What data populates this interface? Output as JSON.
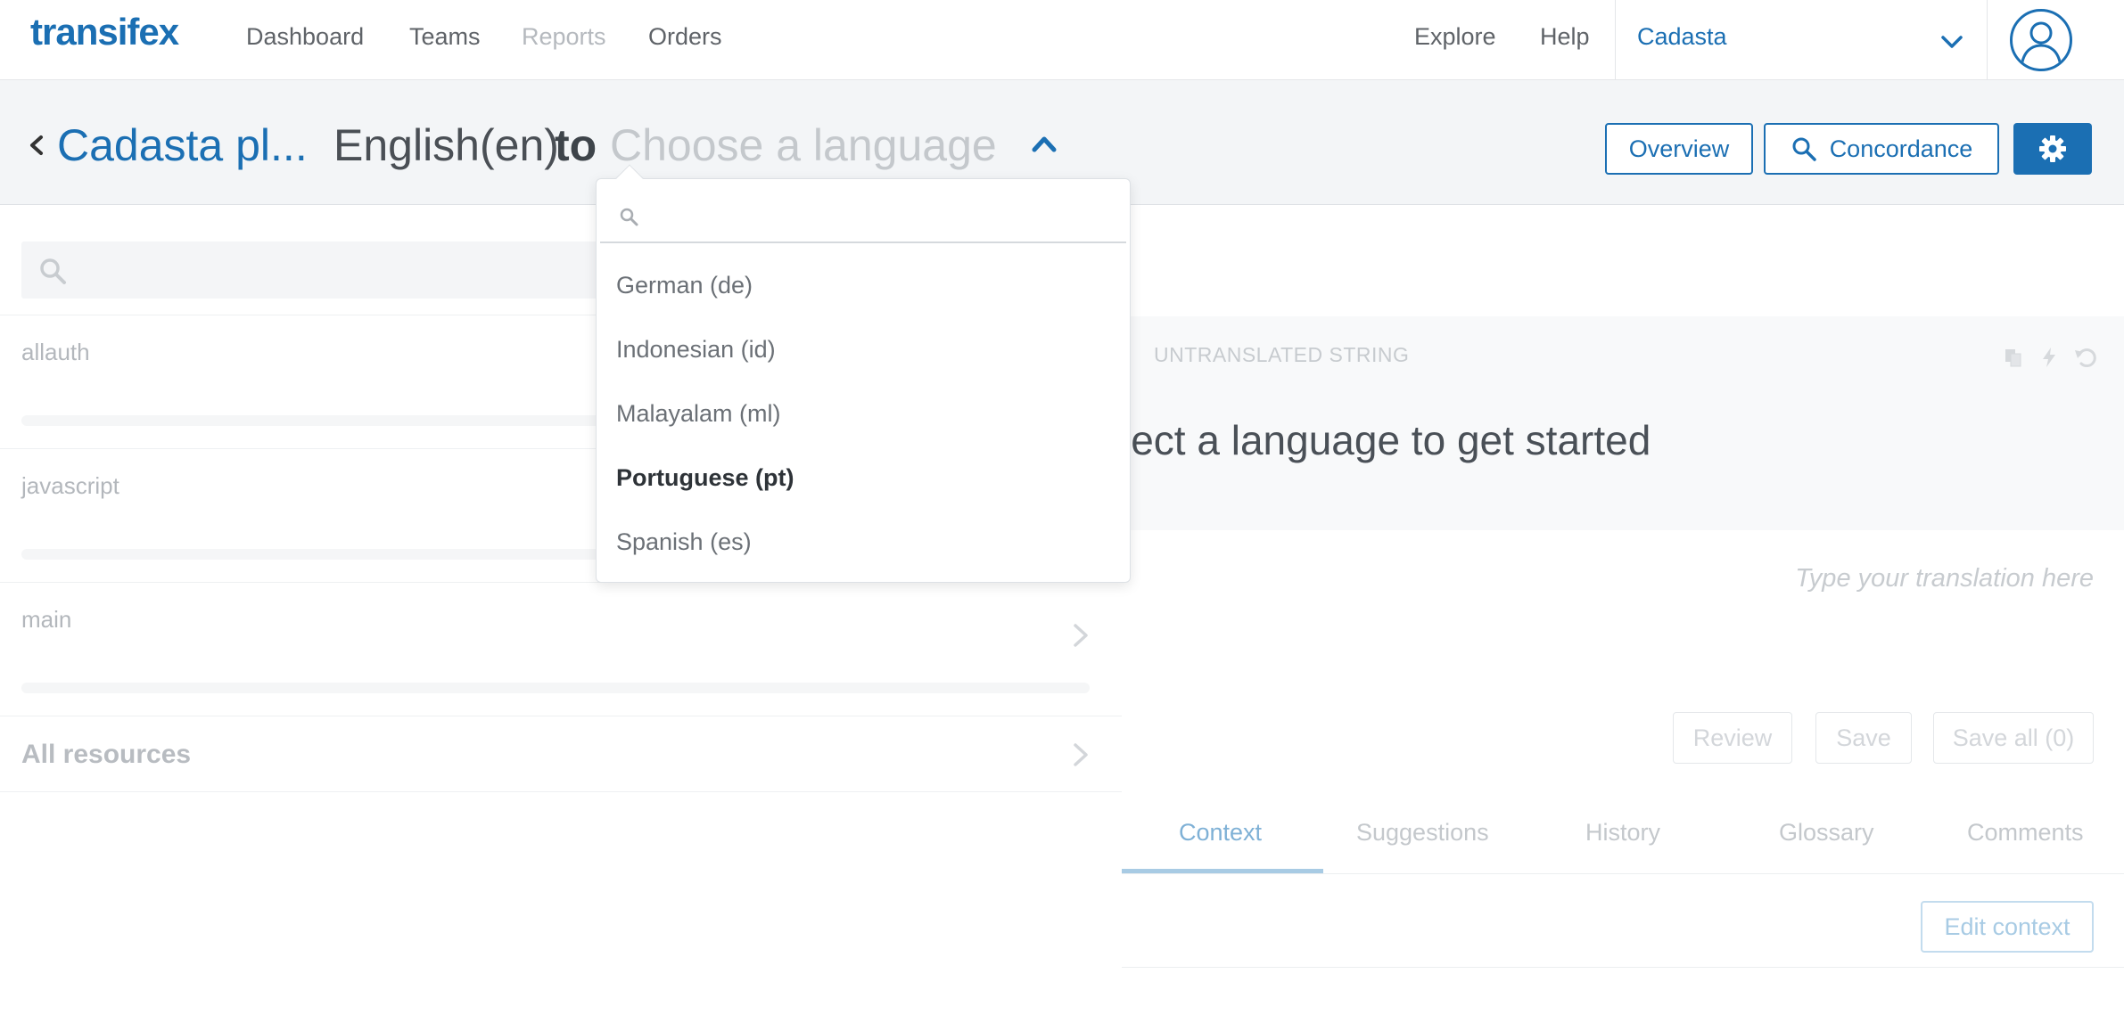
{
  "nav": {
    "logo": "transifex",
    "links": [
      "Dashboard",
      "Teams",
      "Reports",
      "Orders"
    ],
    "right_links": [
      "Explore",
      "Help"
    ],
    "organization": "Cadasta",
    "icons": {
      "org_dropdown": "chevron-down-icon",
      "avatar": "user-avatar-icon"
    }
  },
  "header": {
    "project": "Cadasta pl...",
    "source_language": "English(en)",
    "to_word": "to",
    "target_placeholder": "Choose a language",
    "buttons": {
      "overview": "Overview",
      "concordance": "Concordance"
    },
    "icons": {
      "back": "chevron-left-icon",
      "caret": "chevron-up-icon",
      "search": "search-icon",
      "settings": "gear-icon"
    }
  },
  "language_dropdown": {
    "search_placeholder": "",
    "items": [
      "German (de)",
      "Indonesian (id)",
      "Malayalam (ml)",
      "Portuguese (pt)",
      "Spanish (es)"
    ],
    "highlighted": "Portuguese (pt)"
  },
  "resources": {
    "items": [
      "allauth",
      "javascript",
      "main"
    ],
    "all_label": "All resources"
  },
  "editor": {
    "status_label": "UNTRANSLATED STRING",
    "prompt": "lect a language to get started",
    "translation_placeholder": "Type your translation here",
    "buttons": {
      "review": "Review",
      "save": "Save",
      "save_all": "Save all (0)"
    },
    "tabs": [
      "Context",
      "Suggestions",
      "History",
      "Glossary",
      "Comments"
    ],
    "active_tab": "Context",
    "edit_context": "Edit context"
  },
  "colors": {
    "brand": "#1b6fb3",
    "header_bg": "#f3f5f7"
  }
}
